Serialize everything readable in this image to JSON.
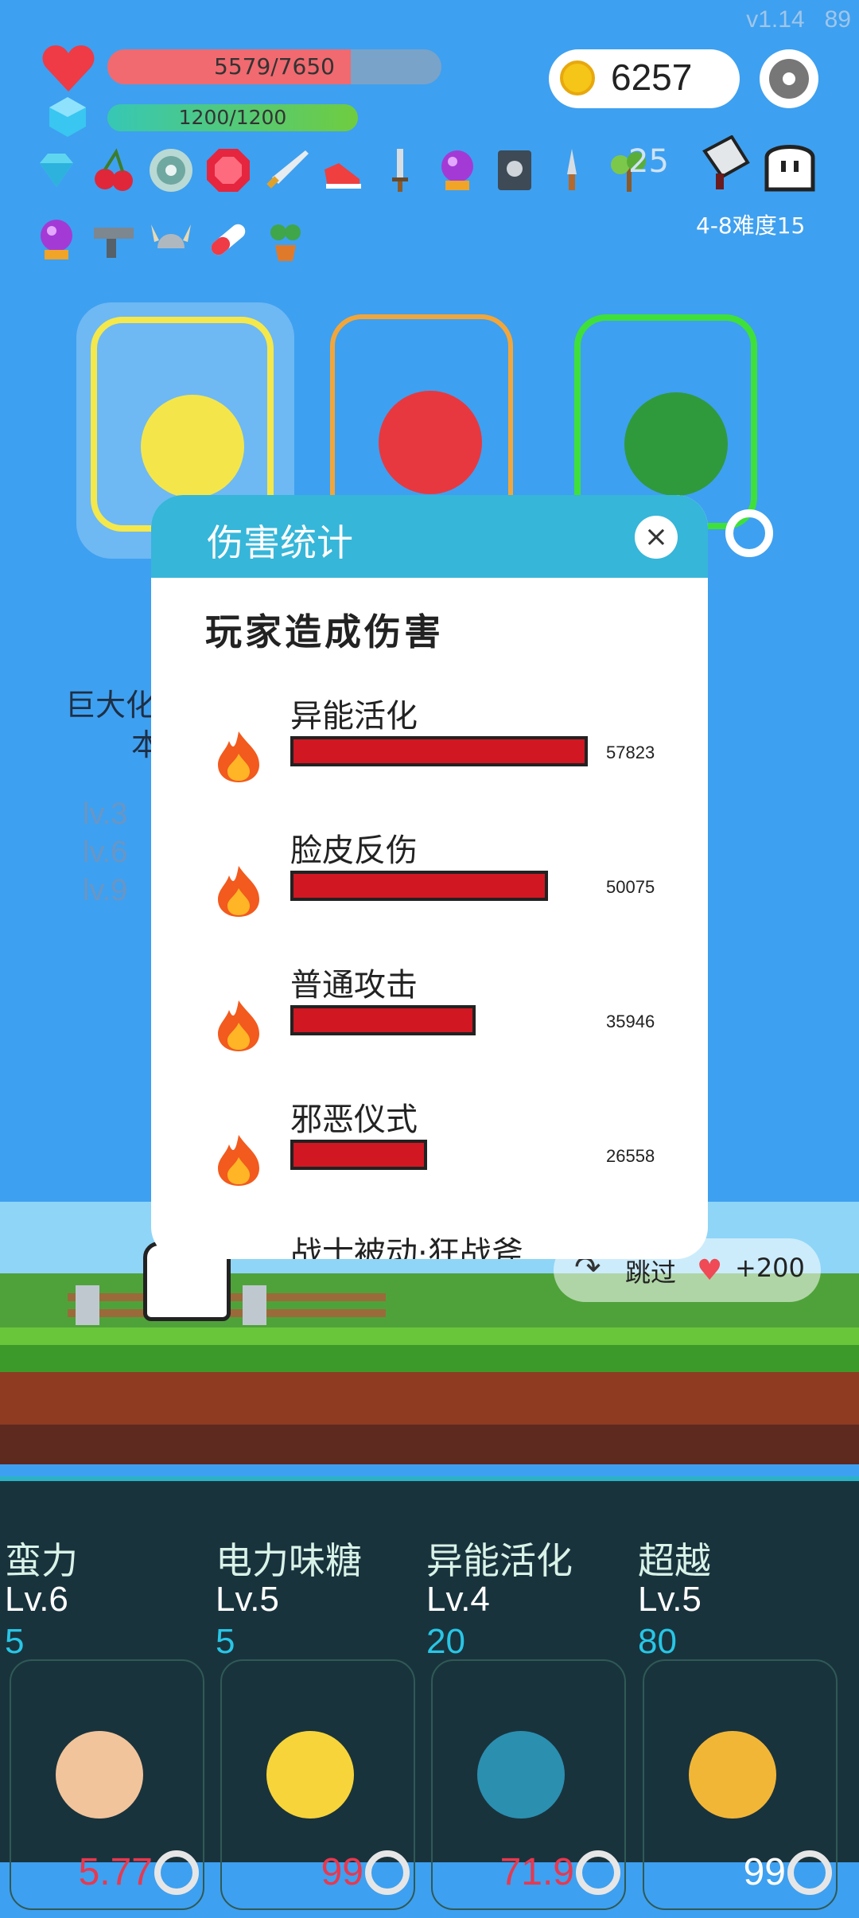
{
  "version": "v1.14",
  "fps": "89",
  "hp": {
    "text": "5579/7650",
    "fraction": 0.729
  },
  "mp": {
    "text": "1200/1200",
    "fraction": 1.0
  },
  "coins": "6257",
  "item_count": "25",
  "stage": "4-8难度15",
  "items": [
    "diamond-icon",
    "cherry-icon",
    "disc-icon",
    "ruby-icon",
    "sword-icon",
    "sneaker-icon",
    "dagger-icon",
    "crystal-ball-icon",
    "skull-book-icon",
    "knife-icon",
    "sapling-icon",
    "cleaver-icon",
    "ghost-icon",
    "crystal-ball-icon",
    "uzi-icon",
    "viking-helmet-icon",
    "pill-icon",
    "potted-plant-icon"
  ],
  "background_text": {
    "desc_line1": "巨大化",
    "desc_line2": "本",
    "levels": [
      "lv.3",
      "lv.6",
      "lv.9"
    ]
  },
  "dialog": {
    "title": "伤害统计",
    "close": "×",
    "subtitle": "玩家造成伤害",
    "rows": [
      {
        "name": "异能活化",
        "value": "57823",
        "fraction": 1.0
      },
      {
        "name": "脸皮反伤",
        "value": "50075",
        "fraction": 0.866
      },
      {
        "name": "普通攻击",
        "value": "35946",
        "fraction": 0.622
      },
      {
        "name": "邪恶仪式",
        "value": "26558",
        "fraction": 0.459
      },
      {
        "name": "战士被动·狂战斧",
        "value": "",
        "fraction": 0
      }
    ]
  },
  "skip": {
    "label": "跳过",
    "reward": "+200"
  },
  "skills": [
    {
      "name": "蛮力",
      "level": "Lv.6",
      "value": "5",
      "number": "5.77",
      "icon": "muscle-icon",
      "color": "#f2c49b"
    },
    {
      "name": "电力味糖",
      "level": "Lv.5",
      "value": "5",
      "number": "99",
      "icon": "lollipop-icon",
      "color": "#f7d43a"
    },
    {
      "name": "异能活化",
      "level": "Lv.4",
      "value": "20",
      "number": "71.9",
      "icon": "crosshair-icon",
      "color": "#2b8fb0"
    },
    {
      "name": "超越",
      "level": "Lv.5",
      "value": "80",
      "number": "99",
      "icon": "hourglass-icon",
      "color": "#f2b637"
    }
  ]
}
